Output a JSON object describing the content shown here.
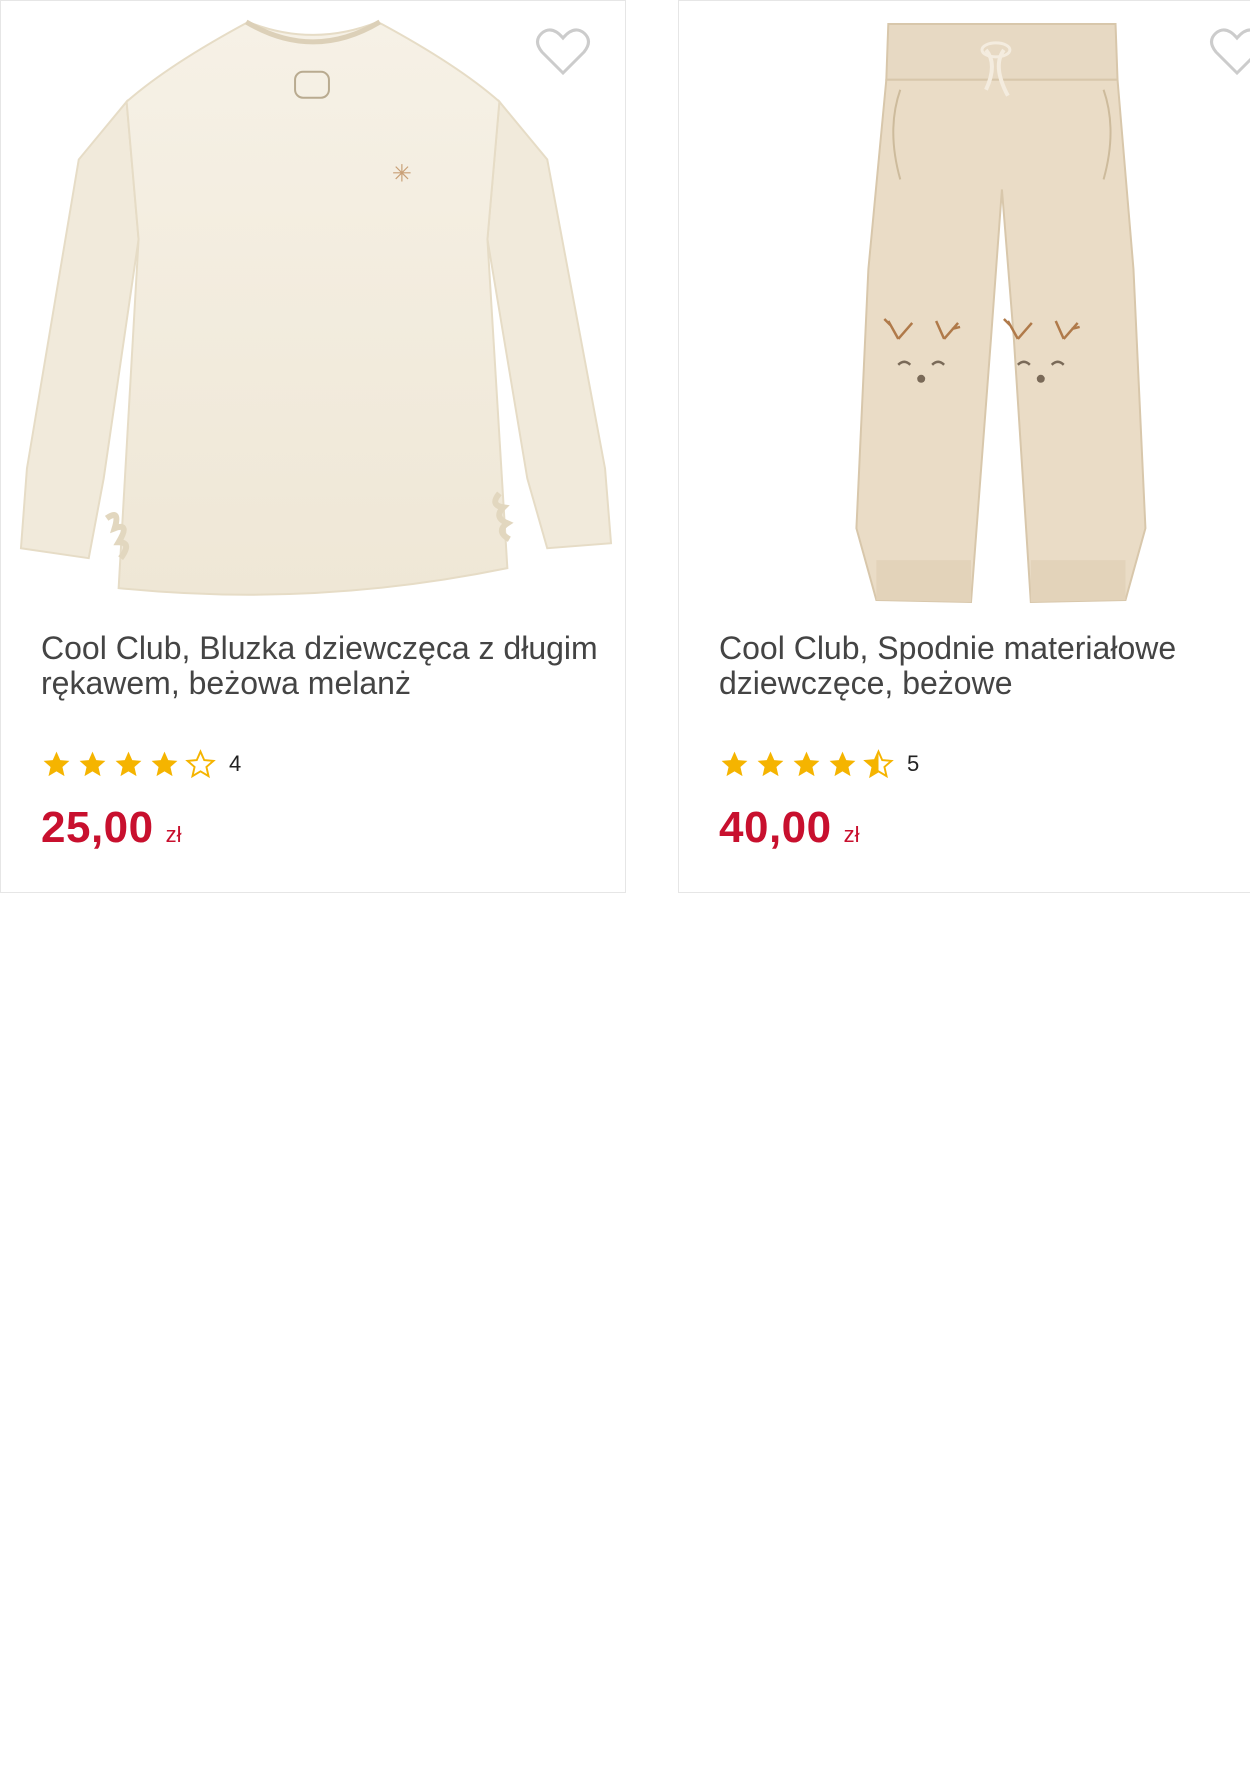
{
  "colors": {
    "price": "#c8102e",
    "star": "#f5b400",
    "title": "#444444",
    "heart_outline": "#cccccc"
  },
  "products": [
    {
      "title": "Cool Club, Bluzka dziewczęca z długim rękawem, beżowa melanż",
      "rating": 4,
      "rating_count": "4",
      "price": "25,00",
      "currency": "zł",
      "image_icon": "beige-long-sleeve-blouse",
      "favorite_icon": "heart-outline-icon"
    },
    {
      "title": "Cool Club, Spodnie materiałowe dziewczęce, beżowe",
      "rating": 4.5,
      "rating_count": "5",
      "price": "40,00",
      "currency": "zł",
      "image_icon": "beige-trousers-with-reindeer",
      "favorite_icon": "heart-outline-icon"
    }
  ]
}
